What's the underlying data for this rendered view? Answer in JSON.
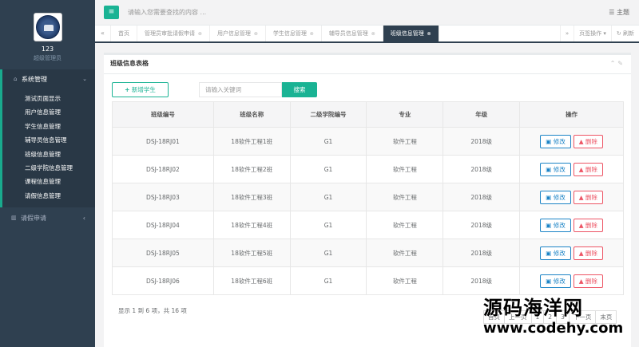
{
  "sidebar": {
    "user_name": "123",
    "user_role": "超级管理员",
    "menu_system": {
      "label": "系统管理",
      "icon": "home-icon",
      "arrow": "‹"
    },
    "items": [
      {
        "label": "测试页面显示"
      },
      {
        "label": "用户信息管理"
      },
      {
        "label": "学生信息管理"
      },
      {
        "label": "辅导员信息管理"
      },
      {
        "label": "班级信息管理"
      },
      {
        "label": "二级学院信息管理"
      },
      {
        "label": "课程信息管理"
      },
      {
        "label": "请假信息管理"
      }
    ],
    "menu_leave": {
      "label": "请假申请",
      "icon": "bar-chart-icon",
      "arrow": "‹"
    }
  },
  "topbar": {
    "search_placeholder": "请输入您需要查找的内容 ...",
    "theme_label": "主题"
  },
  "tabs": {
    "items": [
      {
        "label": "首页",
        "closable": false
      },
      {
        "label": "管理员审批请假申请",
        "closable": true
      },
      {
        "label": "用户信息管理",
        "closable": true
      },
      {
        "label": "学生信息管理",
        "closable": true
      },
      {
        "label": "辅导员信息管理",
        "closable": true
      },
      {
        "label": "班级信息管理",
        "closable": true,
        "active": true
      }
    ],
    "close_label": "页签操作",
    "refresh_label": "刷新"
  },
  "panel": {
    "title": "班级信息表格",
    "add_button": "新增学生",
    "keyword_placeholder": "请输入关键词",
    "search_button": "搜索",
    "columns": [
      "班级编号",
      "班级名称",
      "二级学院编号",
      "专业",
      "年级",
      "操作"
    ],
    "rows": [
      {
        "code": "DSJ-18RJ01",
        "name": "18软件工程1班",
        "college": "G1",
        "major": "软件工程",
        "grade": "2018级"
      },
      {
        "code": "DSJ-18RJ02",
        "name": "18软件工程2班",
        "college": "G1",
        "major": "软件工程",
        "grade": "2018级"
      },
      {
        "code": "DSJ-18RJ03",
        "name": "18软件工程3班",
        "college": "G1",
        "major": "软件工程",
        "grade": "2018级"
      },
      {
        "code": "DSJ-18RJ04",
        "name": "18软件工程4班",
        "college": "G1",
        "major": "软件工程",
        "grade": "2018级"
      },
      {
        "code": "DSJ-18RJ05",
        "name": "18软件工程5班",
        "college": "G1",
        "major": "软件工程",
        "grade": "2018级"
      },
      {
        "code": "DSJ-18RJ06",
        "name": "18软件工程6班",
        "college": "G1",
        "major": "软件工程",
        "grade": "2018级"
      }
    ],
    "edit_label": "修改",
    "delete_label": "删除",
    "footer_info": "显示 1 到 6 项，共 16 项",
    "pager": [
      "首页",
      "上一页",
      "1",
      "2",
      "3",
      "下一页",
      "末页"
    ]
  },
  "watermark": {
    "cn": "源码海洋网",
    "url": "www.codehy.com"
  },
  "colors": {
    "sidebar_bg": "#2f4050",
    "accent": "#1ab394",
    "edit": "#1c84c6",
    "delete": "#ed5565"
  }
}
